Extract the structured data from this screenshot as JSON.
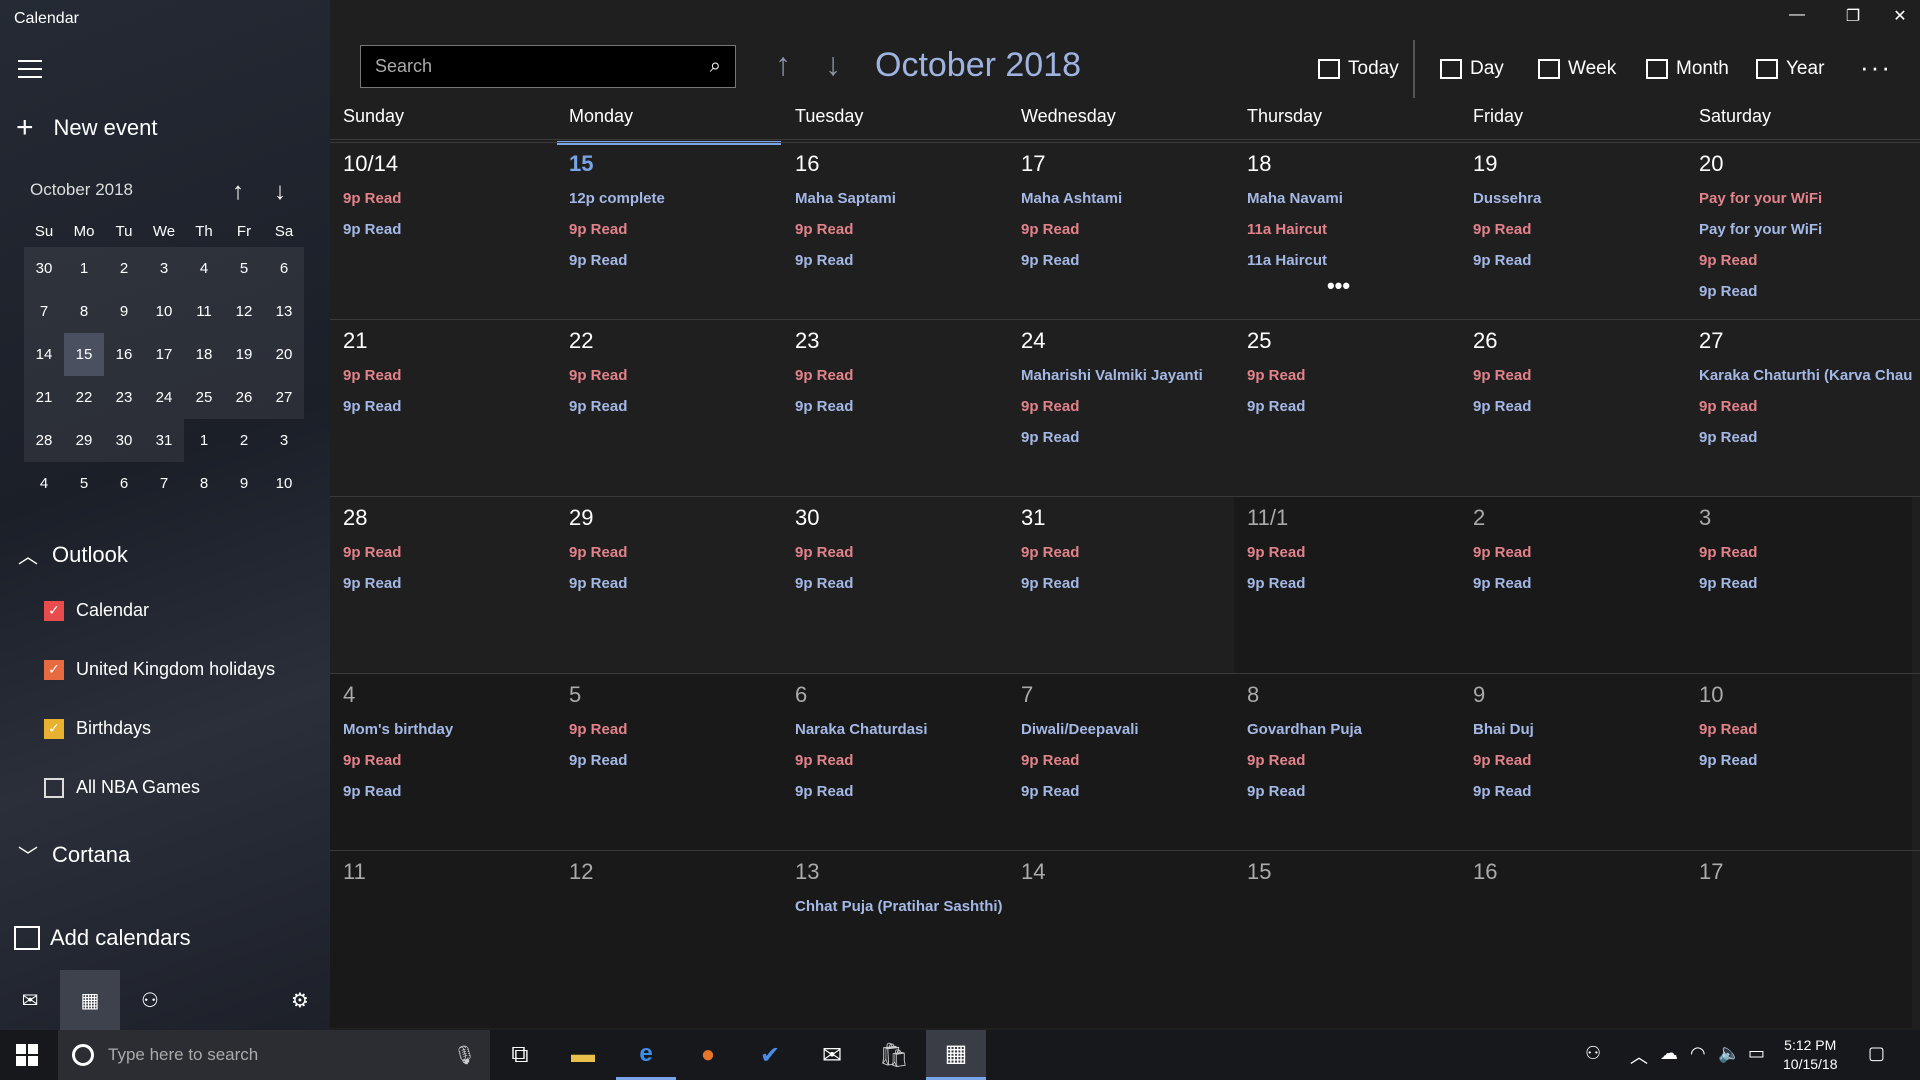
{
  "app": {
    "title": "Calendar"
  },
  "sidebar": {
    "new_event_label": "New event",
    "mini_month_label": "October 2018",
    "weekday_heads": [
      "Su",
      "Mo",
      "Tu",
      "We",
      "Th",
      "Fr",
      "Sa"
    ],
    "mini_weeks": [
      [
        "30",
        "1",
        "2",
        "3",
        "4",
        "5",
        "6"
      ],
      [
        "7",
        "8",
        "9",
        "10",
        "11",
        "12",
        "13"
      ],
      [
        "14",
        "15",
        "16",
        "17",
        "18",
        "19",
        "20"
      ],
      [
        "21",
        "22",
        "23",
        "24",
        "25",
        "26",
        "27"
      ],
      [
        "28",
        "29",
        "30",
        "31",
        "1",
        "2",
        "3"
      ],
      [
        "4",
        "5",
        "6",
        "7",
        "8",
        "9",
        "10"
      ]
    ],
    "outlook_label": "Outlook",
    "calendars": [
      {
        "label": "Calendar",
        "checked": true,
        "color": "#e84c4c"
      },
      {
        "label": "United Kingdom holidays",
        "checked": true,
        "color": "#e86a40"
      },
      {
        "label": "Birthdays",
        "checked": true,
        "color": "#e8b230"
      },
      {
        "label": "All NBA Games",
        "checked": false,
        "color": "#ffffff"
      }
    ],
    "cortana_label": "Cortana",
    "add_calendars_label": "Add calendars"
  },
  "toolbar": {
    "search_placeholder": "Search",
    "month_title": "October 2018",
    "views": [
      "Today",
      "Day",
      "Week",
      "Month",
      "Year"
    ],
    "more": "···"
  },
  "day_headers": [
    "Sunday",
    "Monday",
    "Tuesday",
    "Wednesday",
    "Thursday",
    "Friday",
    "Saturday"
  ],
  "weeks": [
    [
      {
        "d": "10/14",
        "ev": [
          [
            "9p Read",
            "red"
          ],
          [
            "9p Read",
            "blue"
          ]
        ]
      },
      {
        "d": "15",
        "today": true,
        "ev": [
          [
            "12p complete",
            "blue"
          ],
          [
            "9p Read",
            "red"
          ],
          [
            "9p Read",
            "blue"
          ]
        ]
      },
      {
        "d": "16",
        "ev": [
          [
            "Maha Saptami",
            "blue"
          ],
          [
            "9p Read",
            "red"
          ],
          [
            "9p Read",
            "blue"
          ]
        ]
      },
      {
        "d": "17",
        "ev": [
          [
            "Maha Ashtami",
            "blue"
          ],
          [
            "9p Read",
            "red"
          ],
          [
            "9p Read",
            "blue"
          ]
        ]
      },
      {
        "d": "18",
        "ev": [
          [
            "Maha Navami",
            "blue"
          ],
          [
            "11a Haircut",
            "red"
          ],
          [
            "11a Haircut",
            "blue"
          ],
          [
            "•••",
            "more"
          ]
        ]
      },
      {
        "d": "19",
        "ev": [
          [
            "Dussehra",
            "blue"
          ],
          [
            "9p Read",
            "red"
          ],
          [
            "9p Read",
            "blue"
          ]
        ]
      },
      {
        "d": "20",
        "ev": [
          [
            "Pay for your WiFi",
            "red"
          ],
          [
            "Pay for your WiFi",
            "blue"
          ],
          [
            "9p Read",
            "red"
          ],
          [
            "9p Read",
            "blue"
          ]
        ]
      }
    ],
    [
      {
        "d": "21",
        "ev": [
          [
            "9p Read",
            "red"
          ],
          [
            "9p Read",
            "blue"
          ]
        ]
      },
      {
        "d": "22",
        "ev": [
          [
            "9p Read",
            "red"
          ],
          [
            "9p Read",
            "blue"
          ]
        ]
      },
      {
        "d": "23",
        "ev": [
          [
            "9p Read",
            "red"
          ],
          [
            "9p Read",
            "blue"
          ]
        ]
      },
      {
        "d": "24",
        "ev": [
          [
            "Maharishi Valmiki Jayanti",
            "blue"
          ],
          [
            "9p Read",
            "red"
          ],
          [
            "9p Read",
            "blue"
          ]
        ]
      },
      {
        "d": "25",
        "ev": [
          [
            "9p Read",
            "red"
          ],
          [
            "9p Read",
            "blue"
          ]
        ]
      },
      {
        "d": "26",
        "ev": [
          [
            "9p Read",
            "red"
          ],
          [
            "9p Read",
            "blue"
          ]
        ]
      },
      {
        "d": "27",
        "ev": [
          [
            "Karaka Chaturthi (Karva Chauth)",
            "blue"
          ],
          [
            "9p Read",
            "red"
          ],
          [
            "9p Read",
            "blue"
          ]
        ]
      }
    ],
    [
      {
        "d": "28",
        "ev": [
          [
            "9p Read",
            "red"
          ],
          [
            "9p Read",
            "blue"
          ]
        ]
      },
      {
        "d": "29",
        "ev": [
          [
            "9p Read",
            "red"
          ],
          [
            "9p Read",
            "blue"
          ]
        ]
      },
      {
        "d": "30",
        "ev": [
          [
            "9p Read",
            "red"
          ],
          [
            "9p Read",
            "blue"
          ]
        ]
      },
      {
        "d": "31",
        "ev": [
          [
            "9p Read",
            "red"
          ],
          [
            "9p Read",
            "blue"
          ]
        ]
      },
      {
        "d": "11/1",
        "other": true,
        "ev": [
          [
            "9p Read",
            "red"
          ],
          [
            "9p Read",
            "blue"
          ]
        ]
      },
      {
        "d": "2",
        "other": true,
        "ev": [
          [
            "9p Read",
            "red"
          ],
          [
            "9p Read",
            "blue"
          ]
        ]
      },
      {
        "d": "3",
        "other": true,
        "ev": [
          [
            "9p Read",
            "red"
          ],
          [
            "9p Read",
            "blue"
          ]
        ]
      }
    ],
    [
      {
        "d": "4",
        "other": true,
        "ev": [
          [
            "Mom's birthday",
            "blue"
          ],
          [
            "9p Read",
            "red"
          ],
          [
            "9p Read",
            "blue"
          ]
        ]
      },
      {
        "d": "5",
        "other": true,
        "ev": [
          [
            "9p Read",
            "red"
          ],
          [
            "9p Read",
            "blue"
          ]
        ]
      },
      {
        "d": "6",
        "other": true,
        "ev": [
          [
            "Naraka Chaturdasi",
            "blue"
          ],
          [
            "9p Read",
            "red"
          ],
          [
            "9p Read",
            "blue"
          ]
        ]
      },
      {
        "d": "7",
        "other": true,
        "ev": [
          [
            "Diwali/Deepavali",
            "blue"
          ],
          [
            "9p Read",
            "red"
          ],
          [
            "9p Read",
            "blue"
          ]
        ]
      },
      {
        "d": "8",
        "other": true,
        "ev": [
          [
            "Govardhan Puja",
            "blue"
          ],
          [
            "9p Read",
            "red"
          ],
          [
            "9p Read",
            "blue"
          ]
        ]
      },
      {
        "d": "9",
        "other": true,
        "ev": [
          [
            "Bhai Duj",
            "blue"
          ],
          [
            "9p Read",
            "red"
          ],
          [
            "9p Read",
            "blue"
          ]
        ]
      },
      {
        "d": "10",
        "other": true,
        "ev": [
          [
            "9p Read",
            "red"
          ],
          [
            "9p Read",
            "blue"
          ]
        ]
      }
    ],
    [
      {
        "d": "11",
        "other": true,
        "ev": []
      },
      {
        "d": "12",
        "other": true,
        "ev": []
      },
      {
        "d": "13",
        "other": true,
        "ev": [
          [
            "Chhat Puja (Pratihar Sashthi)",
            "blue"
          ]
        ]
      },
      {
        "d": "14",
        "other": true,
        "ev": []
      },
      {
        "d": "15",
        "other": true,
        "ev": []
      },
      {
        "d": "16",
        "other": true,
        "ev": []
      },
      {
        "d": "17",
        "other": true,
        "ev": []
      }
    ]
  ],
  "taskbar": {
    "search_placeholder": "Type here to search",
    "time": "5:12 PM",
    "date": "10/15/18"
  },
  "colors": {
    "accent": "#7aa4e8",
    "event_red": "#e2828a",
    "event_blue": "#a4b8e6"
  }
}
